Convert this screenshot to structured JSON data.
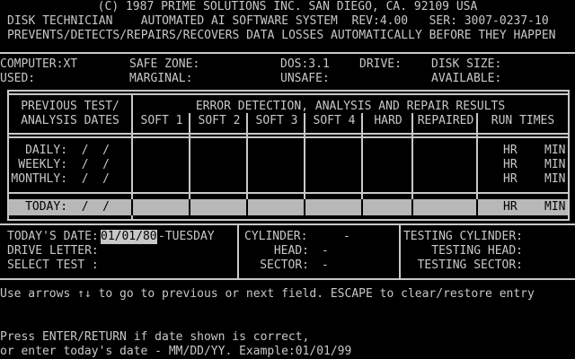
{
  "header": {
    "line1": "(C) 1987 PRIME SOLUTIONS INC. SAN DIEGO, CA. 92109 USA",
    "line2": "DISK TECHNICIAN    AUTOMATED AI SOFTWARE SYSTEM  REV:4.00   SER: 3007-0237-10",
    "line3": "PREVENTS/DETECTS/REPAIRS/RECOVERS DATA LOSSES AUTOMATICALLY BEFORE THEY HAPPEN"
  },
  "sysinfo": {
    "computer": "COMPUTER:XT",
    "used": "USED:",
    "safe_zone": "SAFE ZONE:",
    "marginal": "MARGINAL:",
    "dos": "DOS:3.1",
    "unsafe": "UNSAFE:",
    "drive": "DRIVE:",
    "disk_size": "DISK SIZE:",
    "available": "AVAILABLE:"
  },
  "table": {
    "prev_header_1": "PREVIOUS TEST/",
    "prev_header_2": "ANALYSIS DATES",
    "results_header": "ERROR DETECTION, ANALYSIS AND REPAIR RESULTS",
    "columns": [
      "SOFT 1",
      "SOFT 2",
      "SOFT 3",
      "SOFT 4",
      "HARD",
      "REPAIRED",
      "RUN TIMES"
    ],
    "rows": [
      {
        "label": "DAILY:  /  /",
        "hr": "HR",
        "min": "MIN"
      },
      {
        "label": "WEEKLY:  /  /",
        "hr": "HR",
        "min": "MIN"
      },
      {
        "label": "MONTHLY:  /  /",
        "hr": "HR",
        "min": "MIN"
      }
    ],
    "today": {
      "label": "TODAY:  /  /",
      "hr": "HR",
      "min": "MIN"
    }
  },
  "form": {
    "todays_date_label": "TODAY'S DATE:",
    "todays_date_value": "01/01/80",
    "weekday": "-TUESDAY",
    "drive_letter_label": "DRIVE LETTER:",
    "select_test_label": "SELECT TEST :",
    "cylinder_label": "CYLINDER:",
    "cylinder_value": "-",
    "head_label": "HEAD:",
    "head_value": "-",
    "sector_label": "SECTOR:",
    "sector_value": "-",
    "testing_cylinder": "TESTING CYLINDER:",
    "testing_head": "TESTING HEAD:",
    "testing_sector": "TESTING SECTOR:"
  },
  "help": {
    "arrows": "Use arrows ↑↓ to go to previous or next field. ESCAPE to clear/restore entry",
    "prompt1": "Press ENTER/RETURN if date shown is correct,",
    "prompt2": "or enter today's date - MM/DD/YY. Example:01/01/99"
  }
}
